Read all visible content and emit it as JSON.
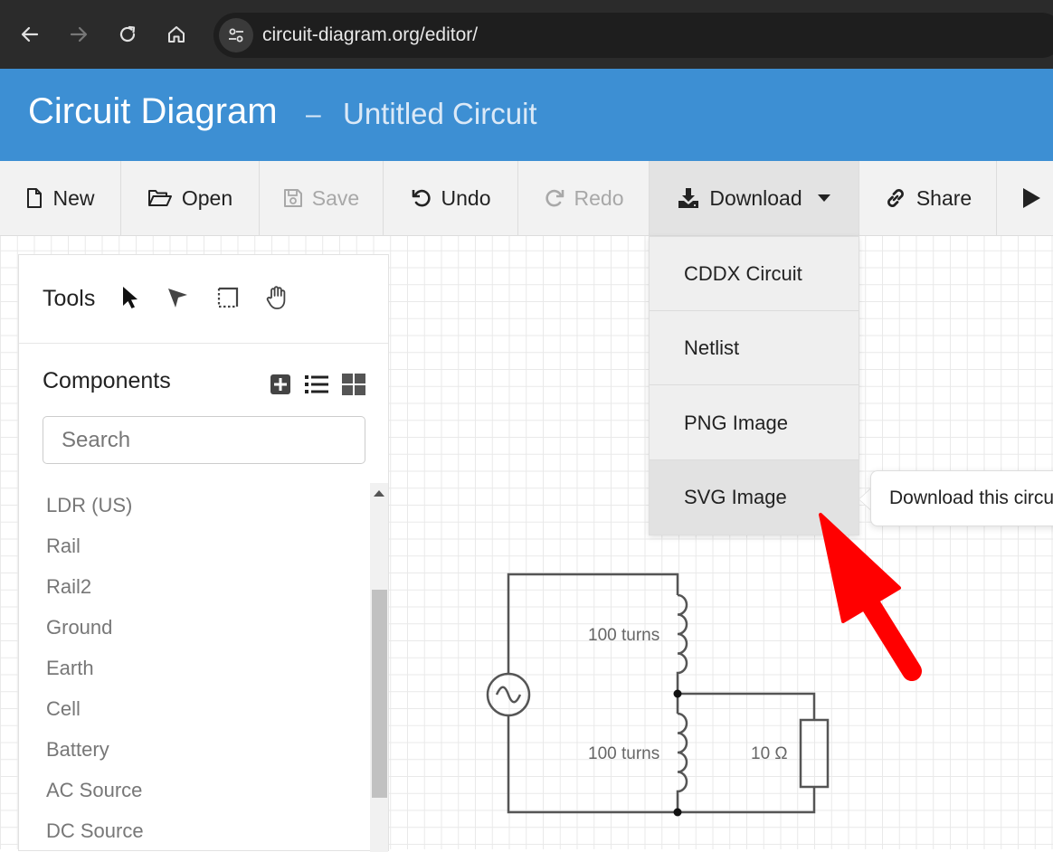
{
  "browser": {
    "url": "circuit-diagram.org/editor/"
  },
  "header": {
    "app_title": "Circuit Diagram",
    "separator": "–",
    "doc_title": "Untitled Circuit"
  },
  "toolbar": {
    "new_label": "New",
    "open_label": "Open",
    "save_label": "Save",
    "undo_label": "Undo",
    "redo_label": "Redo",
    "download_label": "Download",
    "share_label": "Share"
  },
  "download_menu": {
    "items": [
      "CDDX Circuit",
      "Netlist",
      "PNG Image",
      "SVG Image"
    ]
  },
  "tooltip": {
    "text": "Download this circuit"
  },
  "sidebar": {
    "tools_label": "Tools",
    "components_label": "Components",
    "search_placeholder": "Search",
    "components": [
      "LDR (US)",
      "Rail",
      "Rail2",
      "Ground",
      "Earth",
      "Cell",
      "Battery",
      "AC Source",
      "DC Source"
    ]
  },
  "circuit": {
    "inductor_top_label": "100 turns",
    "inductor_bottom_label": "100 turns",
    "resistor_label": "10 Ω"
  },
  "colors": {
    "header_blue": "#3d8fd3",
    "annotation_red": "#ff0000"
  }
}
